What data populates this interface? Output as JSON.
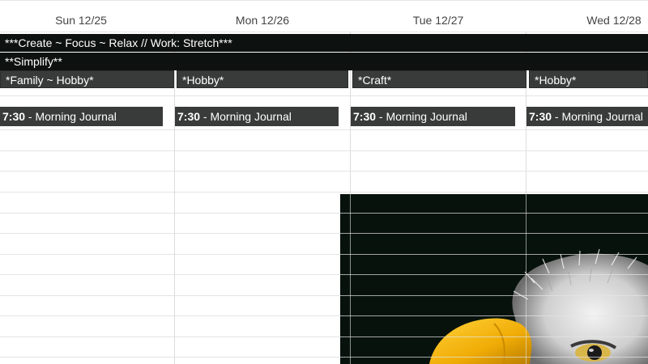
{
  "days": [
    {
      "label": "Sun 12/25"
    },
    {
      "label": "Mon 12/26"
    },
    {
      "label": "Tue 12/27"
    },
    {
      "label": "Wed 12/28"
    }
  ],
  "allday_banners": [
    {
      "label": "***Create ~ Focus ~ Relax // Work: Stretch***"
    },
    {
      "label": "**Simplify**"
    }
  ],
  "day_chips": [
    {
      "label": "*Family ~ Hobby*"
    },
    {
      "label": "*Hobby*"
    },
    {
      "label": "*Craft*"
    },
    {
      "label": "*Hobby*"
    }
  ],
  "events": [
    {
      "time": "7:30",
      "title": " - Morning Journal"
    },
    {
      "time": "7:30",
      "title": " - Morning Journal"
    },
    {
      "time": "7:30",
      "title": " - Morning Journal"
    },
    {
      "time": "7:30",
      "title": " - Morning Journal"
    }
  ],
  "colors": {
    "banner_bg": "#0d1210",
    "chip_bg": "#383b3a",
    "grid": "#e4e4e4",
    "photo_bg": "#07120d",
    "beak": "#f2b705"
  },
  "images": {
    "background_photo": "bald-eagle-photo"
  }
}
